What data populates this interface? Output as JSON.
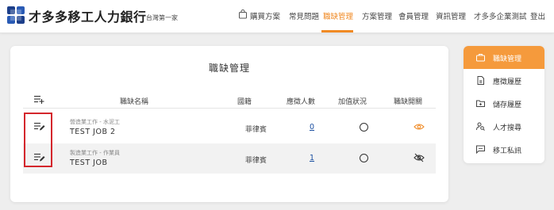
{
  "header": {
    "brand": "才多多移工人力銀行",
    "brand_sub": "台灣第一家",
    "nav": [
      {
        "label": "購買方案",
        "icon": "cart-icon"
      },
      {
        "label": "常見問題"
      },
      {
        "label": "職缺管理",
        "active": true
      },
      {
        "label": "方案管理"
      },
      {
        "label": "會員管理"
      },
      {
        "label": "資訊管理"
      },
      {
        "label": "才多多企業測試"
      },
      {
        "label": "登出"
      }
    ],
    "accent_color": "#f08a24"
  },
  "main": {
    "title": "職缺管理",
    "columns": [
      "職缺名稱",
      "國籍",
      "應徵人數",
      "加值狀況",
      "職缺開關"
    ],
    "rows": [
      {
        "category": "營造業工作 - 水泥工",
        "title": "TEST JOB 2",
        "nationality": "菲律賓",
        "applicants": "0",
        "addon_icon": "circle-icon",
        "visibility_icon": "eye-icon"
      },
      {
        "category": "製造業工作 - 作業員",
        "title": "TEST JOB",
        "nationality": "菲律賓",
        "applicants": "1",
        "addon_icon": "circle-icon",
        "visibility_icon": "eye-off-icon"
      }
    ]
  },
  "sidebar": {
    "items": [
      {
        "label": "職缺管理",
        "icon": "briefcase-icon",
        "active": true
      },
      {
        "label": "應徵履歷",
        "icon": "document-icon"
      },
      {
        "label": "儲存履歷",
        "icon": "folder-icon"
      },
      {
        "label": "人才搜尋",
        "icon": "person-search-icon"
      },
      {
        "label": "移工私訊",
        "icon": "chat-icon"
      }
    ],
    "active_color": "#f59a3c"
  }
}
